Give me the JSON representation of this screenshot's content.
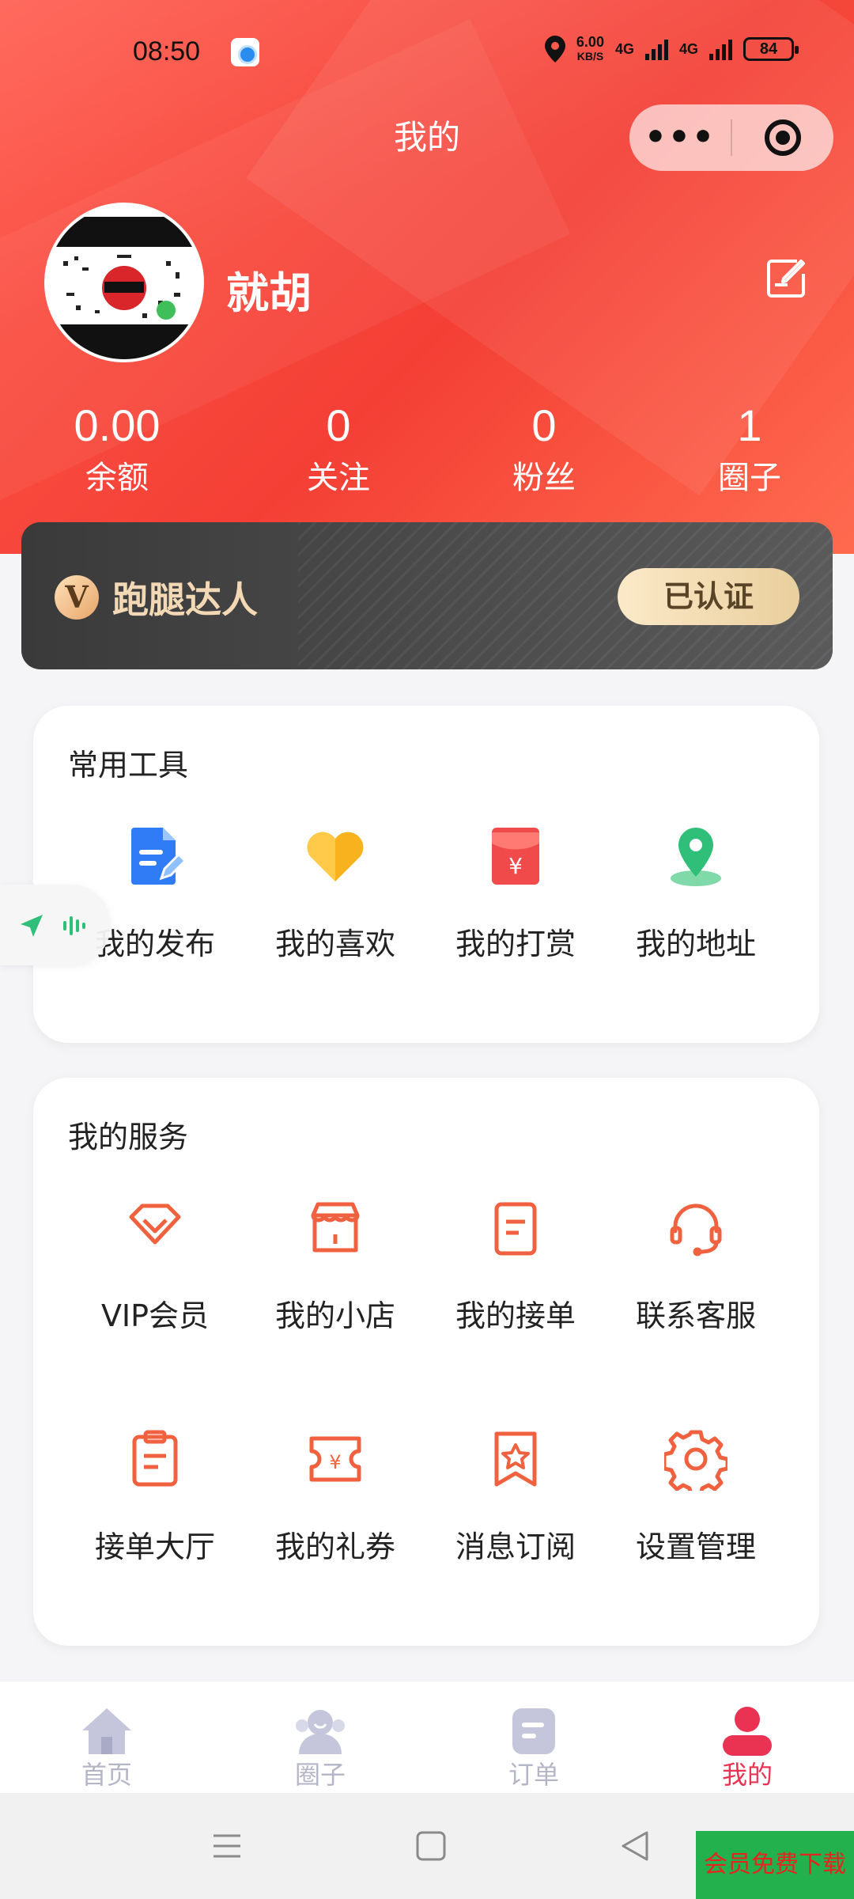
{
  "status_bar": {
    "time": "08:50",
    "speed_top": "6.00",
    "speed_bottom": "KB/S",
    "net1": "4G",
    "net2": "4G",
    "battery": "84"
  },
  "header": {
    "title": "我的",
    "capsule_more": "•••"
  },
  "profile": {
    "username": "就胡"
  },
  "stats": [
    {
      "value": "0.00",
      "label": "余额"
    },
    {
      "value": "0",
      "label": "关注"
    },
    {
      "value": "0",
      "label": "粉丝"
    },
    {
      "value": "1",
      "label": "圈子"
    }
  ],
  "cert": {
    "icon_letter": "V",
    "title": "跑腿达人",
    "badge": "已认证"
  },
  "tools": {
    "title": "常用工具",
    "items": [
      {
        "label": "我的发布",
        "icon": "document-edit-icon",
        "color": "#2f7cf6"
      },
      {
        "label": "我的喜欢",
        "icon": "heart-icon",
        "color": "#f7b21e"
      },
      {
        "label": "我的打赏",
        "icon": "red-envelope-icon",
        "color": "#f04a4a"
      },
      {
        "label": "我的地址",
        "icon": "location-pin-icon",
        "color": "#2fbf78"
      }
    ]
  },
  "services": {
    "title": "我的服务",
    "items": [
      {
        "label": "VIP会员",
        "icon": "diamond-icon"
      },
      {
        "label": "我的小店",
        "icon": "shop-icon"
      },
      {
        "label": "我的接单",
        "icon": "order-doc-icon"
      },
      {
        "label": "联系客服",
        "icon": "headset-icon"
      },
      {
        "label": "接单大厅",
        "icon": "clipboard-icon"
      },
      {
        "label": "我的礼券",
        "icon": "coupon-icon"
      },
      {
        "label": "消息订阅",
        "icon": "bookmark-star-icon"
      },
      {
        "label": "设置管理",
        "icon": "gear-icon"
      }
    ],
    "accent": "#f0623f"
  },
  "tabbar": {
    "items": [
      {
        "label": "首页",
        "icon": "home-icon"
      },
      {
        "label": "圈子",
        "icon": "community-icon"
      },
      {
        "label": "订单",
        "icon": "order-icon"
      },
      {
        "label": "我的",
        "icon": "user-icon",
        "active": true
      }
    ],
    "inactive_color": "#c5c6dc",
    "active_color": "#ea3353"
  },
  "promo": {
    "text": "会员免费下载"
  }
}
